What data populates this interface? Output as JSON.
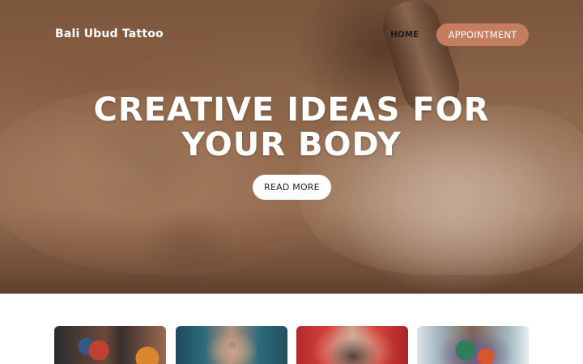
{
  "header": {
    "brand": "Bali Ubud Tattoo",
    "nav": {
      "home": "HOME"
    },
    "appointment_label": "APPOINTMENT"
  },
  "hero": {
    "headline_line1": "CREATIVE IDEAS FOR",
    "headline_line2": "YOUR BODY",
    "cta_label": "READ MORE",
    "image_subject": "tattoo artist tattooing an arm"
  },
  "gallery": {
    "items": [
      {
        "subject": "colorful floral sleeve tattoo"
      },
      {
        "subject": "back of neck tattoo"
      },
      {
        "subject": "mandala back tattoo"
      },
      {
        "subject": "full color back piece tattoo"
      }
    ]
  },
  "colors": {
    "accent": "#c47d5e",
    "hero_tone": "#a57a5a",
    "button_text": "#222222",
    "background": "#ffffff"
  }
}
